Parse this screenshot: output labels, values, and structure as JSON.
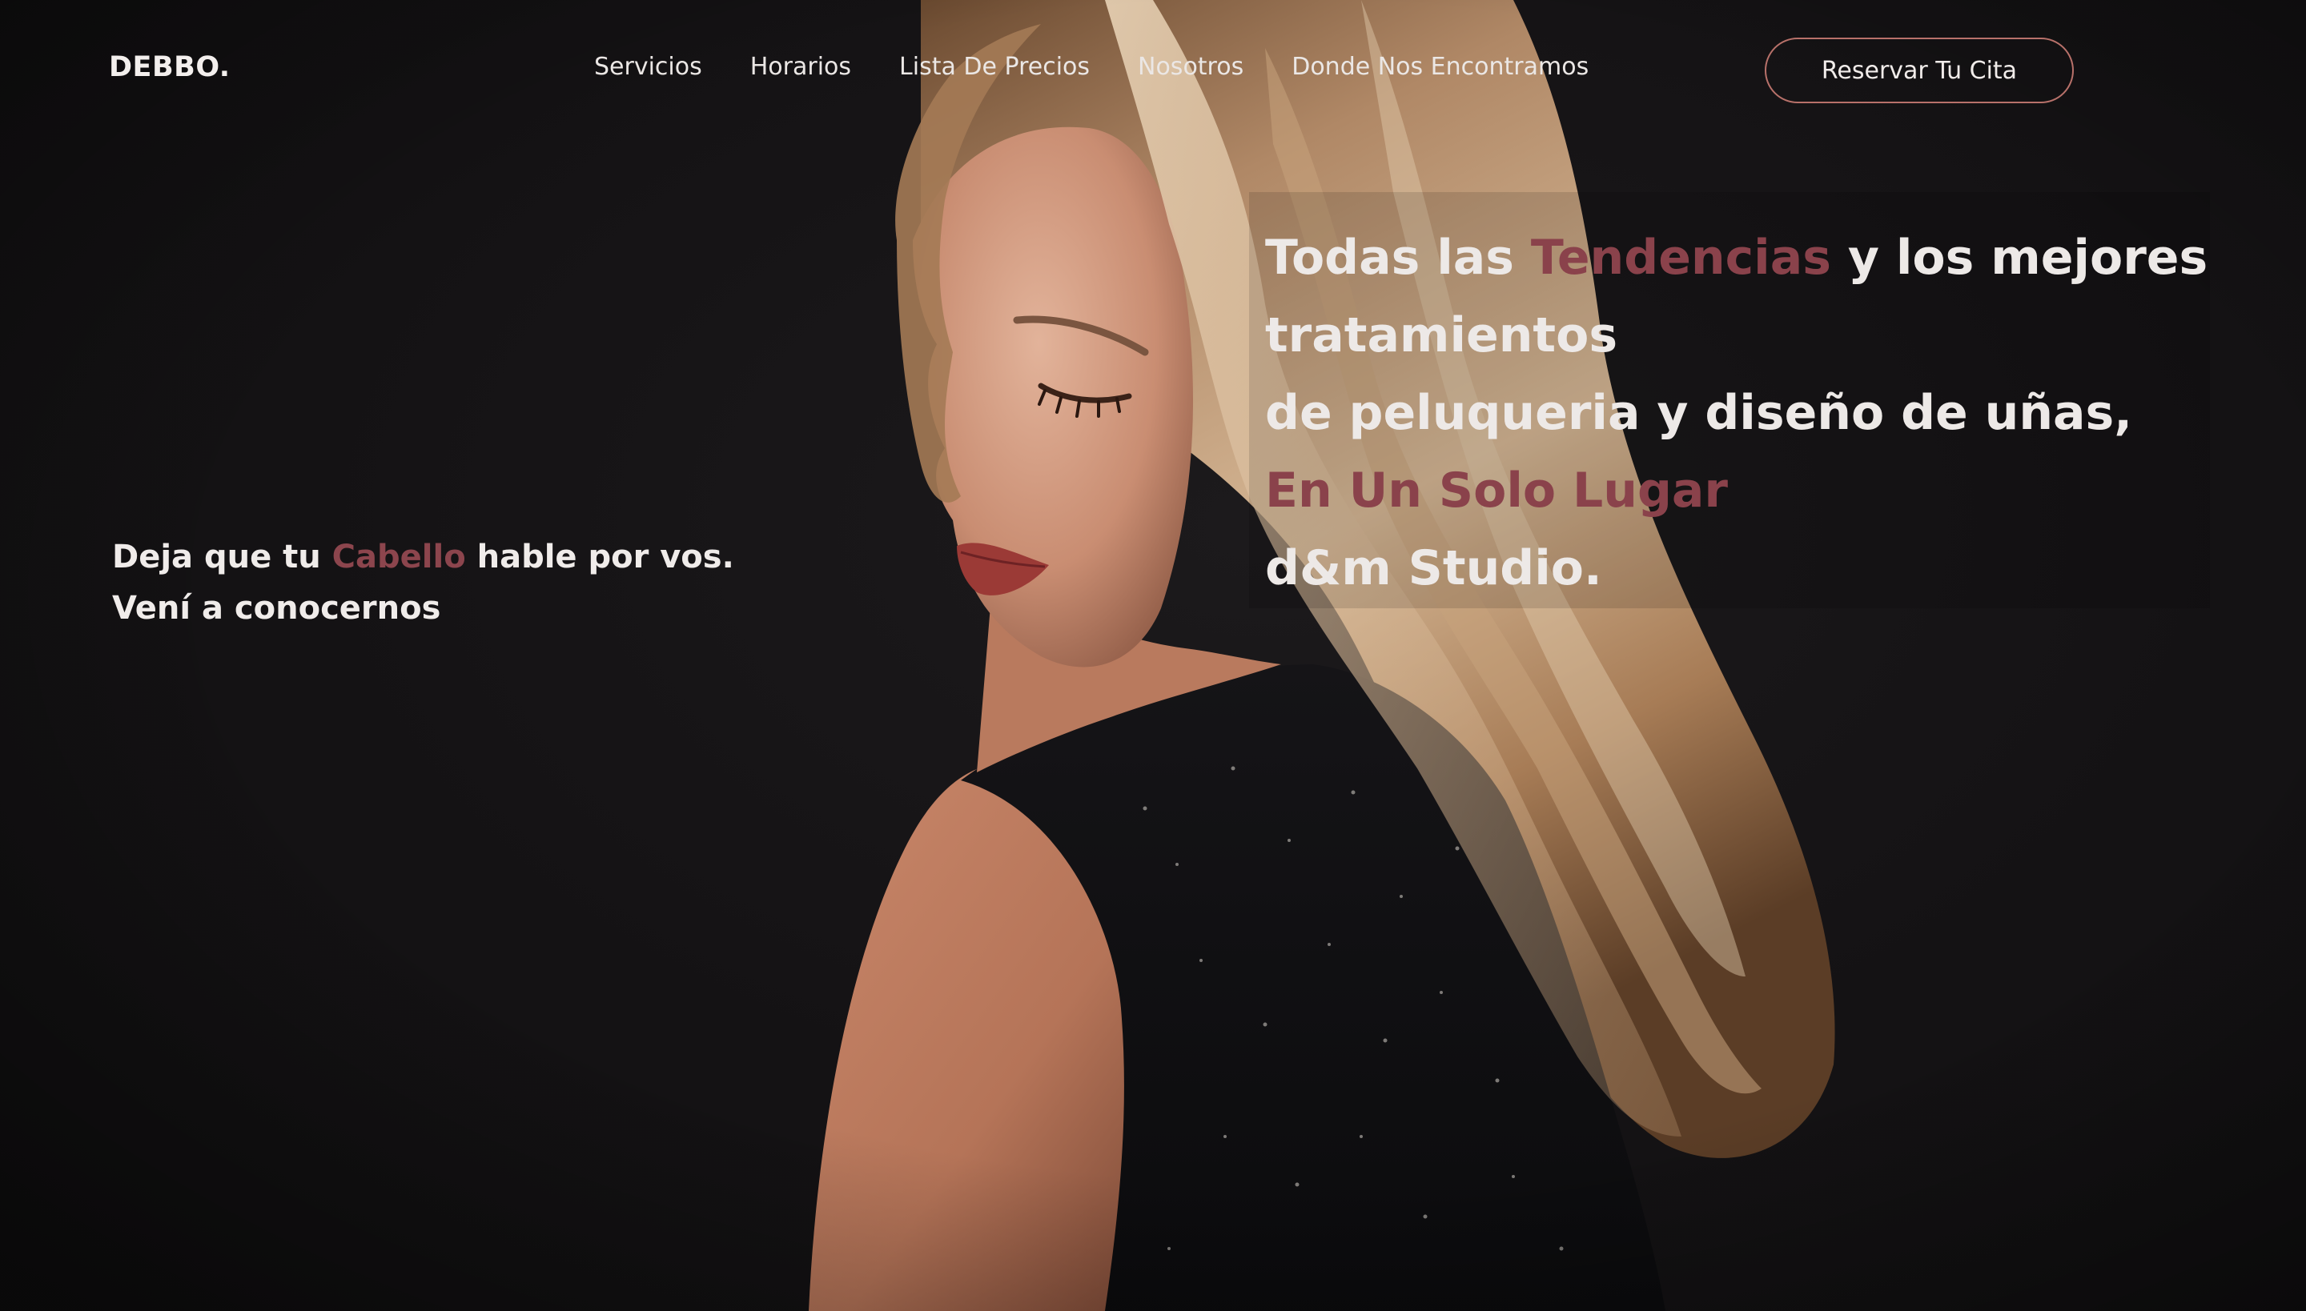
{
  "brand": {
    "name": "DEBBO."
  },
  "nav": {
    "items": [
      {
        "label": "Servicios"
      },
      {
        "label": "Horarios"
      },
      {
        "label": "Lista De Precios"
      },
      {
        "label": "Nosotros"
      },
      {
        "label": "Donde Nos Encontramos"
      }
    ]
  },
  "cta": {
    "label": "Reservar Tu Cita"
  },
  "tagline": {
    "line1_pre": "Deja que tu ",
    "line1_accent": "Cabello",
    "line1_post": " hable por vos.",
    "line2": "Vení a conocernos"
  },
  "headline": {
    "line1_pre": "Todas las ",
    "line1_accent": "Tendencias",
    "line1_post": " y los mejores",
    "line2": "tratamientos",
    "line3": "de peluqueria y diseño de uñas,",
    "line4_accent": "En Un Solo Lugar",
    "line5": "d&m Studio."
  },
  "colors": {
    "background": "#141214",
    "accent": "#8c454d",
    "cta_border": "#b8716a",
    "text": "#ece8e6"
  },
  "icons": {
    "hero": "woman-portrait-photo"
  }
}
